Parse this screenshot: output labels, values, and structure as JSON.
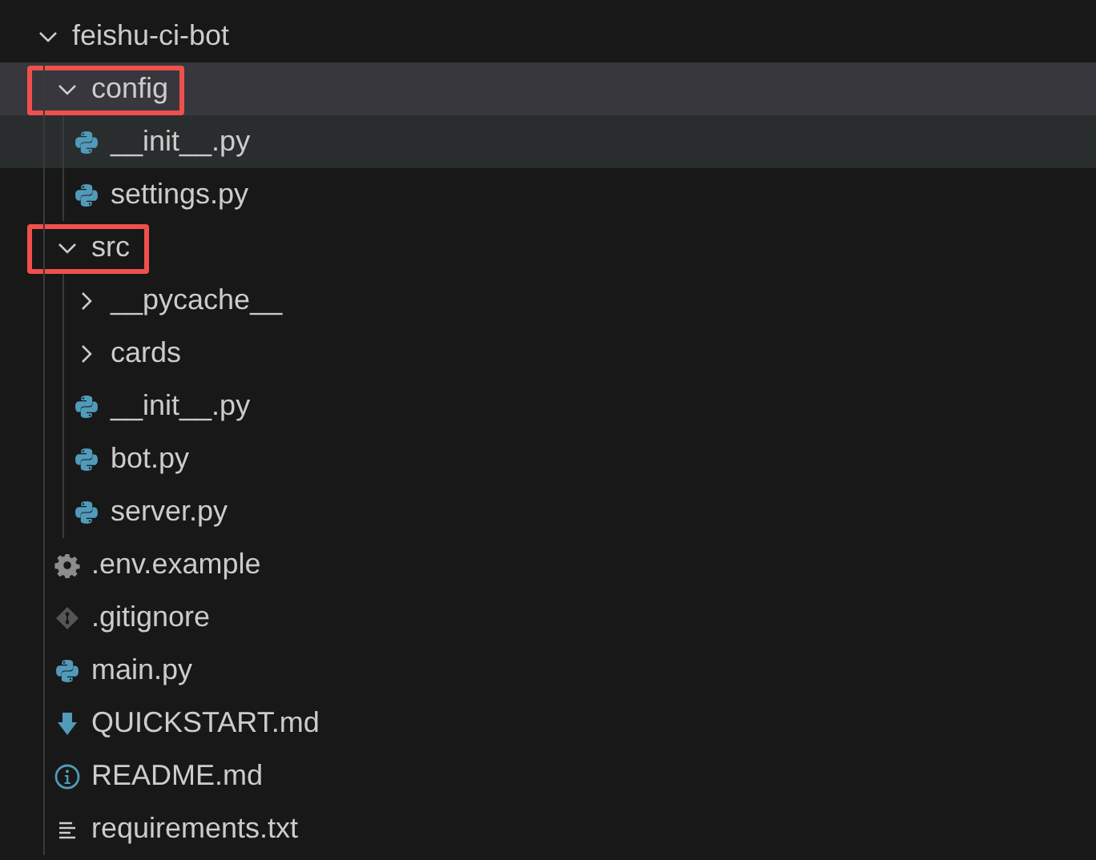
{
  "tree": [
    {
      "name": "feishu-ci-bot",
      "kind": "folder",
      "expanded": true,
      "selected": false,
      "hovered": false,
      "highlighted": false,
      "children": [
        {
          "name": "config",
          "kind": "folder",
          "expanded": true,
          "selected": true,
          "hovered": false,
          "highlighted": true,
          "children": [
            {
              "name": "__init__.py",
              "kind": "python",
              "selected": false,
              "hovered": true
            },
            {
              "name": "settings.py",
              "kind": "python",
              "selected": false,
              "hovered": false
            }
          ]
        },
        {
          "name": "src",
          "kind": "folder",
          "expanded": true,
          "selected": false,
          "hovered": false,
          "highlighted": true,
          "children": [
            {
              "name": "__pycache__",
              "kind": "folder",
              "expanded": false,
              "selected": false,
              "hovered": false,
              "highlighted": false
            },
            {
              "name": "cards",
              "kind": "folder",
              "expanded": false,
              "selected": false,
              "hovered": false,
              "highlighted": false
            },
            {
              "name": "__init__.py",
              "kind": "python",
              "selected": false,
              "hovered": false
            },
            {
              "name": "bot.py",
              "kind": "python",
              "selected": false,
              "hovered": false
            },
            {
              "name": "server.py",
              "kind": "python",
              "selected": false,
              "hovered": false
            }
          ]
        },
        {
          "name": ".env.example",
          "kind": "config",
          "selected": false,
          "hovered": false
        },
        {
          "name": ".gitignore",
          "kind": "git",
          "selected": false,
          "hovered": false
        },
        {
          "name": "main.py",
          "kind": "python",
          "selected": false,
          "hovered": false
        },
        {
          "name": "QUICKSTART.md",
          "kind": "download",
          "selected": false,
          "hovered": false
        },
        {
          "name": "README.md",
          "kind": "info",
          "selected": false,
          "hovered": false
        },
        {
          "name": "requirements.txt",
          "kind": "text",
          "selected": false,
          "hovered": false
        }
      ]
    }
  ]
}
